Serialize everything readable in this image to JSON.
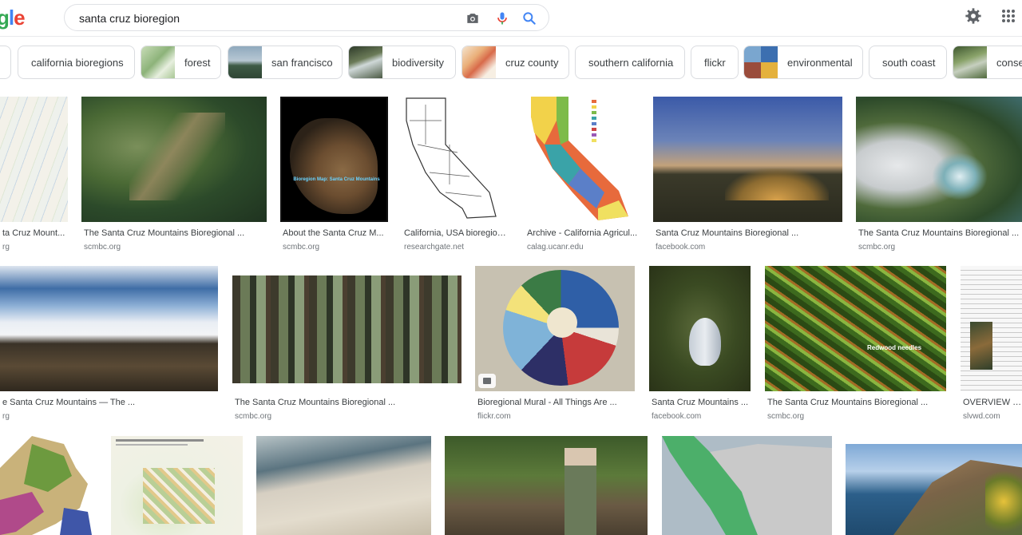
{
  "header": {
    "logo_partial": "gle",
    "query": "santa cruz bioregion",
    "icons": [
      "camera-icon",
      "microphone-icon",
      "search-icon",
      "gear-icon",
      "apps-grid-icon"
    ]
  },
  "chips": [
    {
      "label": "",
      "thumb": ""
    },
    {
      "label": "california bioregions",
      "thumb": ""
    },
    {
      "label": "forest",
      "thumb": "#9bc08a"
    },
    {
      "label": "san francisco",
      "thumb": "#6b8a9c"
    },
    {
      "label": "biodiversity",
      "thumb": "#5e6e52"
    },
    {
      "label": "cruz county",
      "thumb": "#e0a070"
    },
    {
      "label": "southern california",
      "thumb": ""
    },
    {
      "label": "flickr",
      "thumb": ""
    },
    {
      "label": "environmental",
      "thumb": "#4a7bb5"
    },
    {
      "label": "south coast",
      "thumb": ""
    },
    {
      "label": "conse",
      "thumb": "#6f8a55"
    }
  ],
  "results": [
    {
      "title": "ta Cruz Mount...",
      "source": "rg"
    },
    {
      "title": "The Santa Cruz Mountains Bioregional ...",
      "source": "scmbc.org"
    },
    {
      "title": "About the Santa Cruz M...",
      "source": "scmbc.org"
    },
    {
      "title": "California, USA bioregion...",
      "source": "researchgate.net"
    },
    {
      "title": "Archive - California Agricul...",
      "source": "calag.ucanr.edu"
    },
    {
      "title": "Santa Cruz Mountains Bioregional ...",
      "source": "facebook.com"
    },
    {
      "title": "The Santa Cruz Mountains Bioregional ...",
      "source": "scmbc.org"
    },
    {
      "title": "e Santa Cruz Mountains — The ...",
      "source": "rg"
    },
    {
      "title": "The Santa Cruz Mountains Bioregional ...",
      "source": "scmbc.org"
    },
    {
      "title": "Bioregional Mural - All Things Are ...",
      "source": "flickr.com"
    },
    {
      "title": "Santa Cruz Mountains ...",
      "source": "facebook.com"
    },
    {
      "title": "The Santa Cruz Mountains Bioregional ...",
      "source": "scmbc.org"
    },
    {
      "title": "OVERVIEW OF B",
      "source": "slvwd.com"
    },
    {
      "title": "",
      "source": ""
    },
    {
      "title": "",
      "source": ""
    },
    {
      "title": "",
      "source": ""
    },
    {
      "title": "",
      "source": ""
    },
    {
      "title": "",
      "source": ""
    },
    {
      "title": "",
      "source": ""
    }
  ],
  "image_captions": {
    "bioregion_map": "Bioregion Map: Santa Cruz Mountains",
    "redwood": "Redwood needles"
  },
  "colors": {
    "border": "#dadce0",
    "title_text": "#3c4043",
    "source_text": "#70757a",
    "blue_icon": "#4285f4",
    "mic_red": "#ea4335"
  }
}
